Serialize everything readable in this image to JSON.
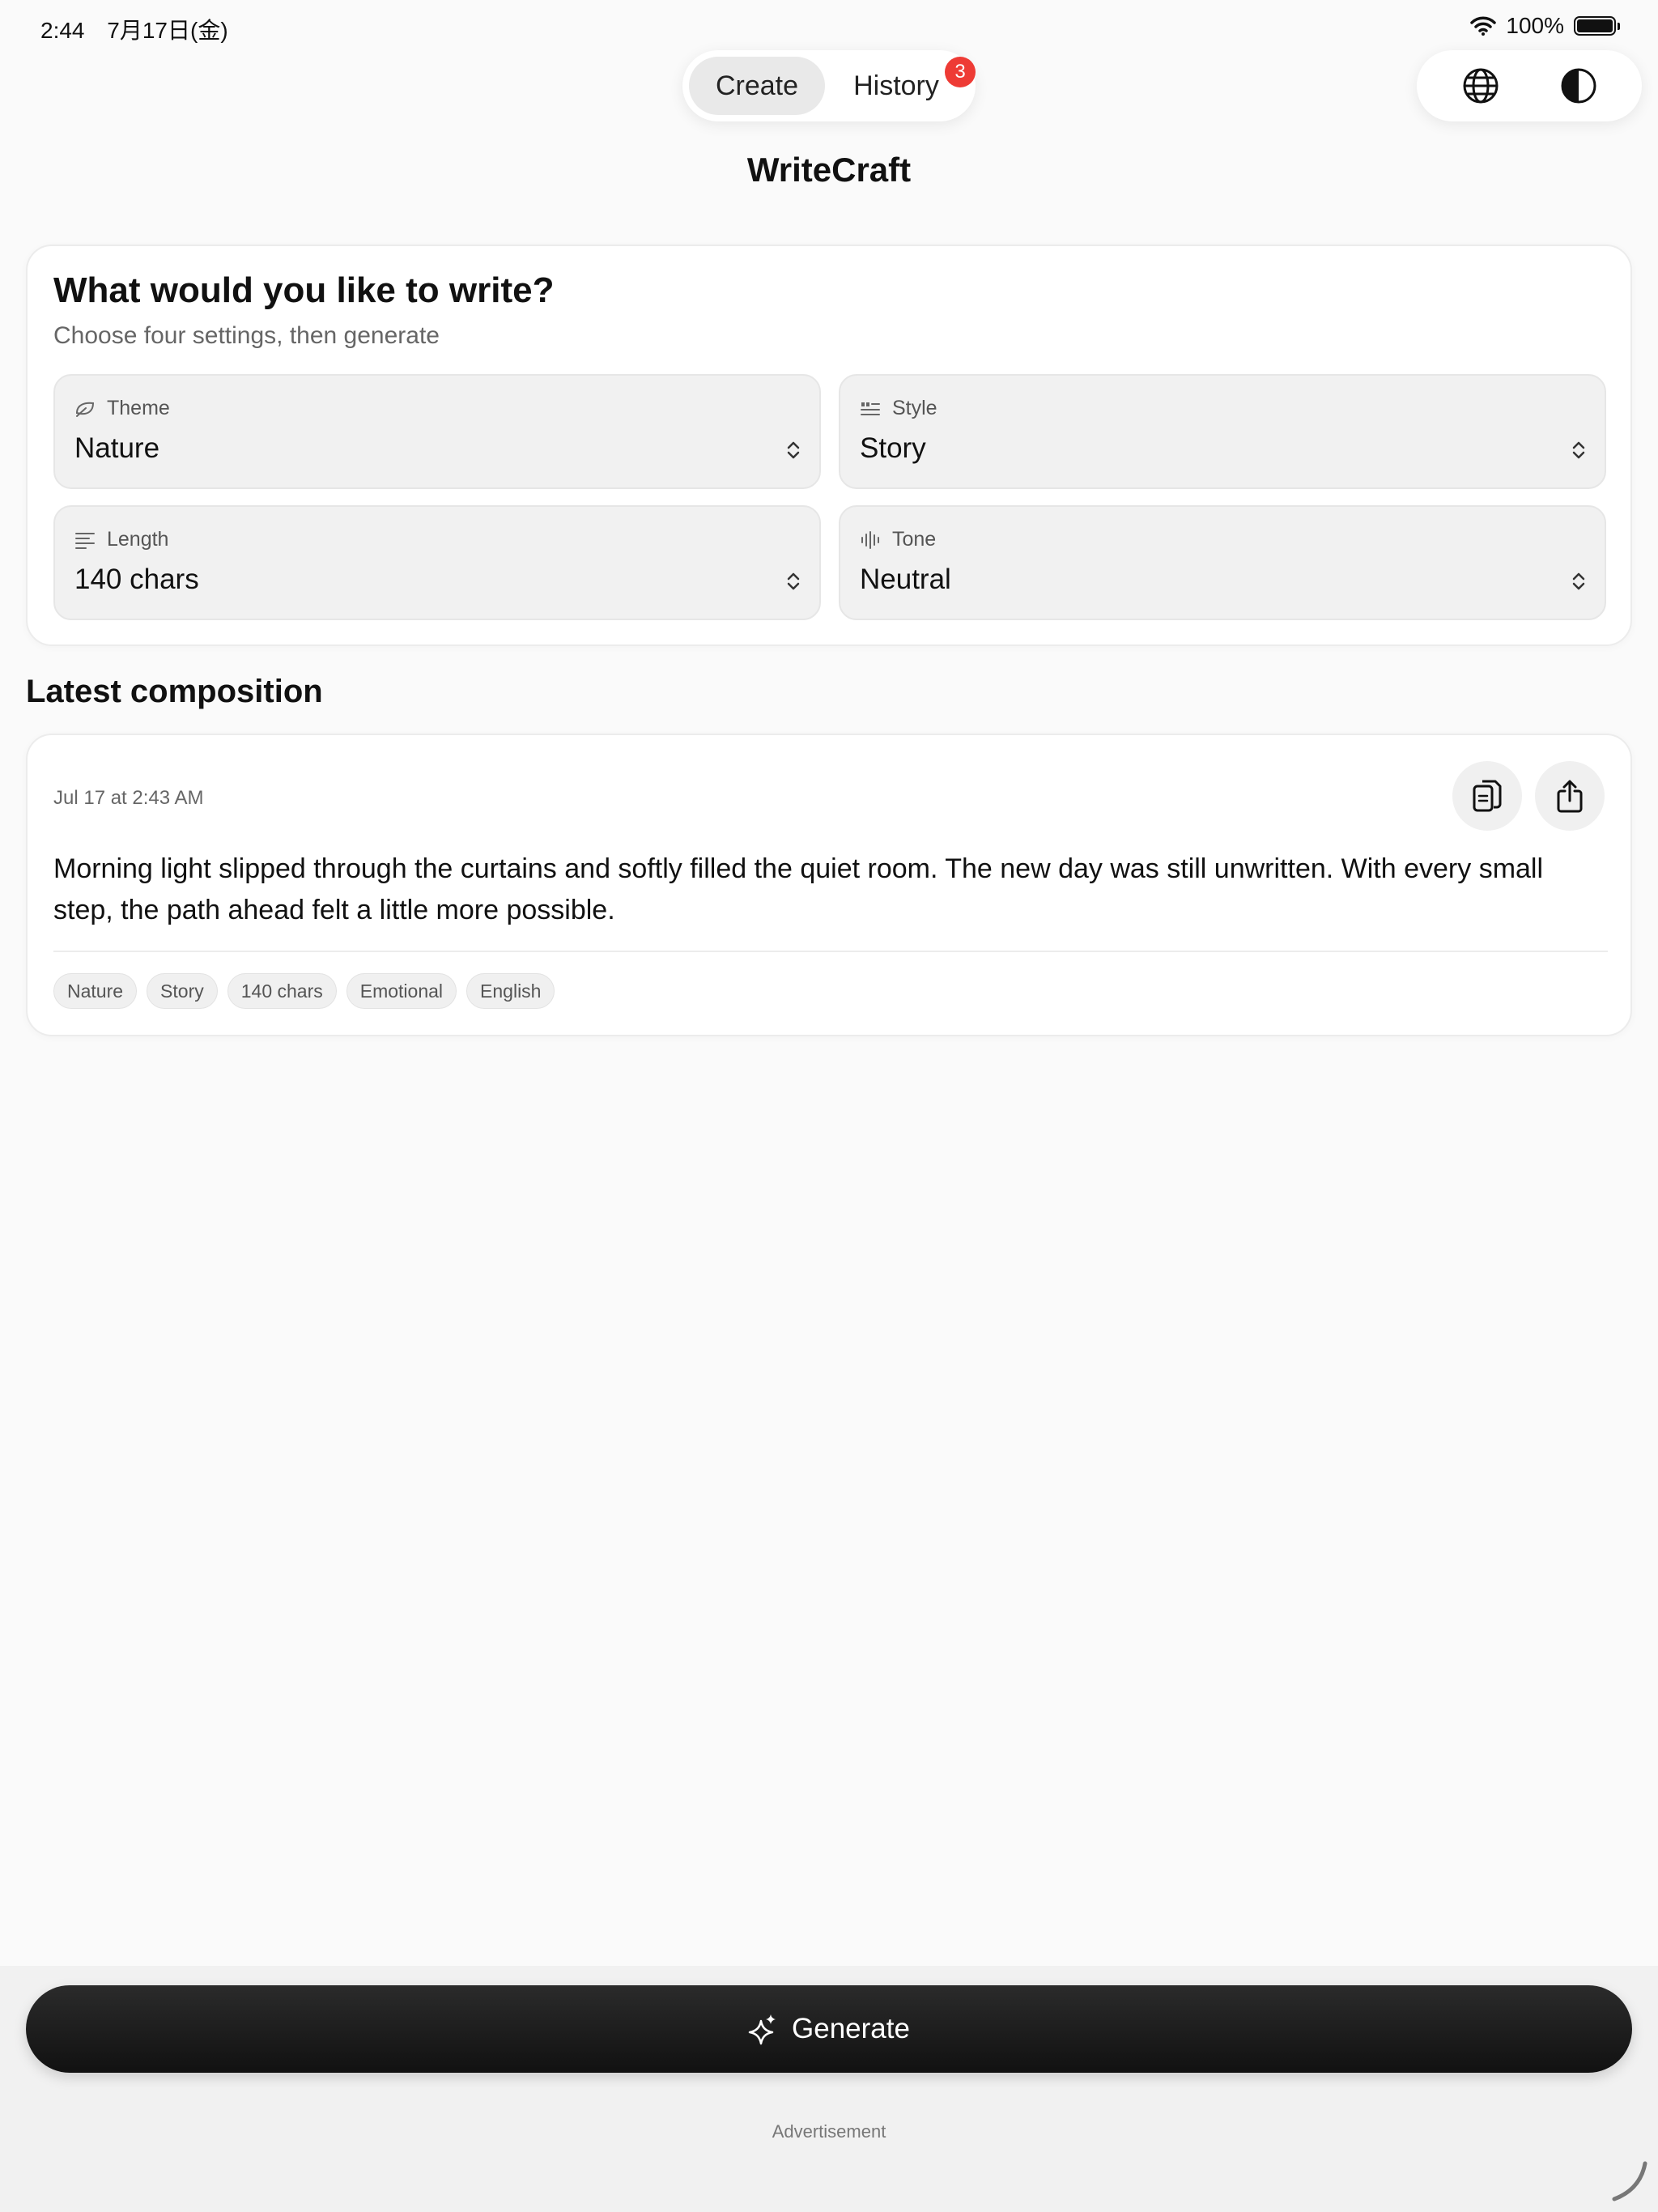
{
  "status_bar": {
    "time": "2:44",
    "date": "7月17日(金)",
    "battery": "100%"
  },
  "nav": {
    "create_label": "Create",
    "history_label": "History",
    "history_badge": "3",
    "globe_icon": "globe-icon",
    "appearance_icon": "contrast-icon"
  },
  "app": {
    "title": "WriteCraft"
  },
  "settings": {
    "title": "What would you like to write?",
    "subtitle": "Choose four settings, then generate",
    "theme": {
      "label": "Theme",
      "value": "Nature",
      "icon": "leaf-icon"
    },
    "style": {
      "label": "Style",
      "value": "Story",
      "icon": "quote-lines-icon"
    },
    "length": {
      "label": "Length",
      "value": "140 chars",
      "icon": "text-lines-icon"
    },
    "tone": {
      "label": "Tone",
      "value": "Neutral",
      "icon": "waveform-icon"
    }
  },
  "latest": {
    "section_title": "Latest composition",
    "date": "Jul 17 at 2:43 AM",
    "text": "Morning light slipped through the curtains and softly filled the quiet room. The new day was still unwritten. With every small step, the path ahead felt a little more possible.",
    "tags": [
      "Nature",
      "Story",
      "140 chars",
      "Emotional",
      "English"
    ],
    "copy_icon": "copy-icon",
    "share_icon": "share-icon"
  },
  "footer": {
    "generate_label": "Generate",
    "ad_label": "Advertisement"
  },
  "colors": {
    "badge": "#ee3b35",
    "button_dark": "#111111",
    "background": "#fafafa"
  }
}
